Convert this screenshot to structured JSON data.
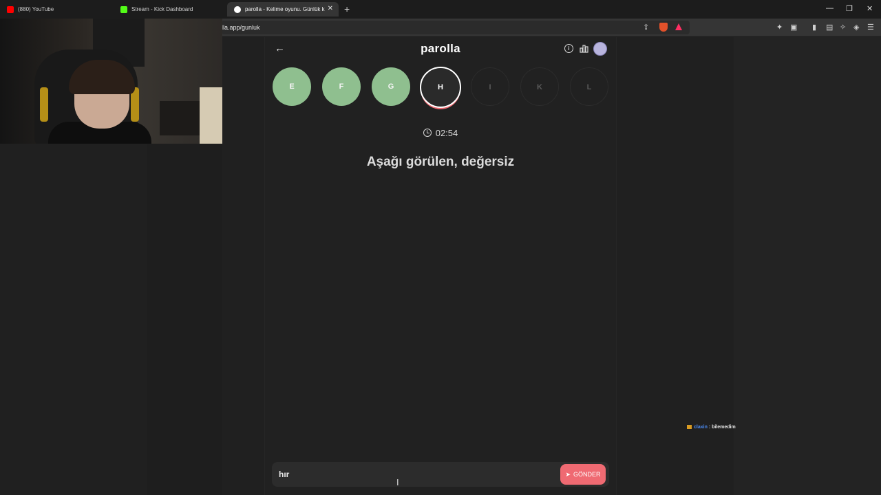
{
  "browser": {
    "tabs": [
      {
        "title": "(880) YouTube",
        "favicon_color": "#ff0000",
        "active": false
      },
      {
        "title": "Stream - Kick Dashboard",
        "favicon_color": "#53fc18",
        "active": false
      },
      {
        "title": "parolla - Kelime oyunu. Günlük k",
        "favicon_color": "#ffffff",
        "active": true
      }
    ],
    "url": "lla.app/gunluk"
  },
  "app": {
    "brand": "parolla",
    "letters": [
      {
        "char": "E",
        "state": "done"
      },
      {
        "char": "F",
        "state": "done"
      },
      {
        "char": "G",
        "state": "done"
      },
      {
        "char": "H",
        "state": "current"
      },
      {
        "char": "I",
        "state": "pending"
      },
      {
        "char": "K",
        "state": "pending"
      },
      {
        "char": "L",
        "state": "pending"
      }
    ],
    "timer": "02:54",
    "question": "Aşağı görülen, değersiz",
    "answer_value": "hır",
    "send_label": "GÖNDER",
    "colors": {
      "done": "#8fbf8f",
      "accent": "#ef6a72",
      "background": "#212121"
    }
  },
  "chat": {
    "user": "claxin",
    "separator": ":",
    "message": "bilemedim"
  }
}
